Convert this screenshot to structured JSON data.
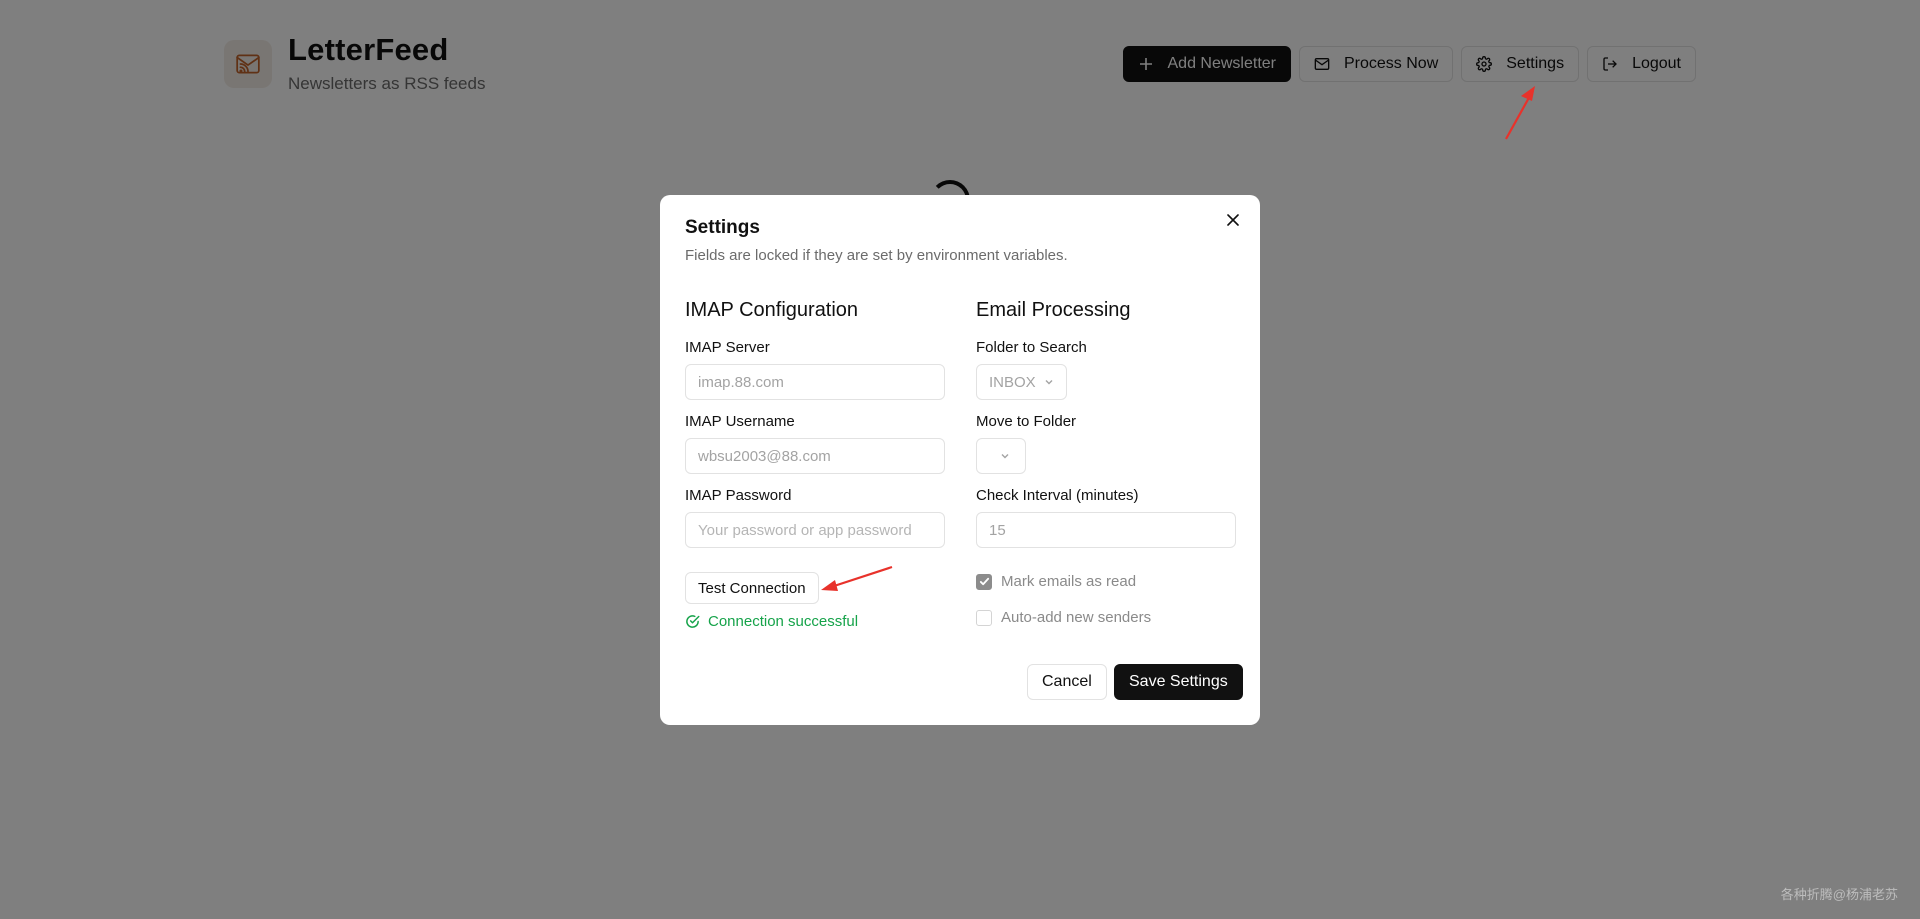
{
  "app": {
    "title": "LetterFeed",
    "subtitle": "Newsletters as RSS feeds"
  },
  "header_buttons": {
    "add": "Add Newsletter",
    "process": "Process Now",
    "settings": "Settings",
    "logout": "Logout"
  },
  "dialog": {
    "title": "Settings",
    "description": "Fields are locked if they are set by environment variables.",
    "imap": {
      "heading": "IMAP Configuration",
      "server_label": "IMAP Server",
      "server_value": "imap.88.com",
      "username_label": "IMAP Username",
      "username_value": "wbsu2003@88.com",
      "password_label": "IMAP Password",
      "password_placeholder": "Your password or app password",
      "test_button": "Test Connection",
      "status": "Connection successful"
    },
    "processing": {
      "heading": "Email Processing",
      "folder_label": "Folder to Search",
      "folder_value": "INBOX",
      "move_label": "Move to Folder",
      "move_value": "",
      "interval_label": "Check Interval (minutes)",
      "interval_value": "15",
      "mark_read_label": "Mark emails as read",
      "mark_read_checked": true,
      "auto_add_label": "Auto-add new senders",
      "auto_add_checked": false
    },
    "cancel": "Cancel",
    "save": "Save Settings"
  },
  "watermark": "各种折腾@杨浦老苏",
  "colors": {
    "accent": "#111111",
    "success": "#16a34a",
    "annotation_arrow": "#e8322b",
    "brand_icon": "#c0622b"
  }
}
